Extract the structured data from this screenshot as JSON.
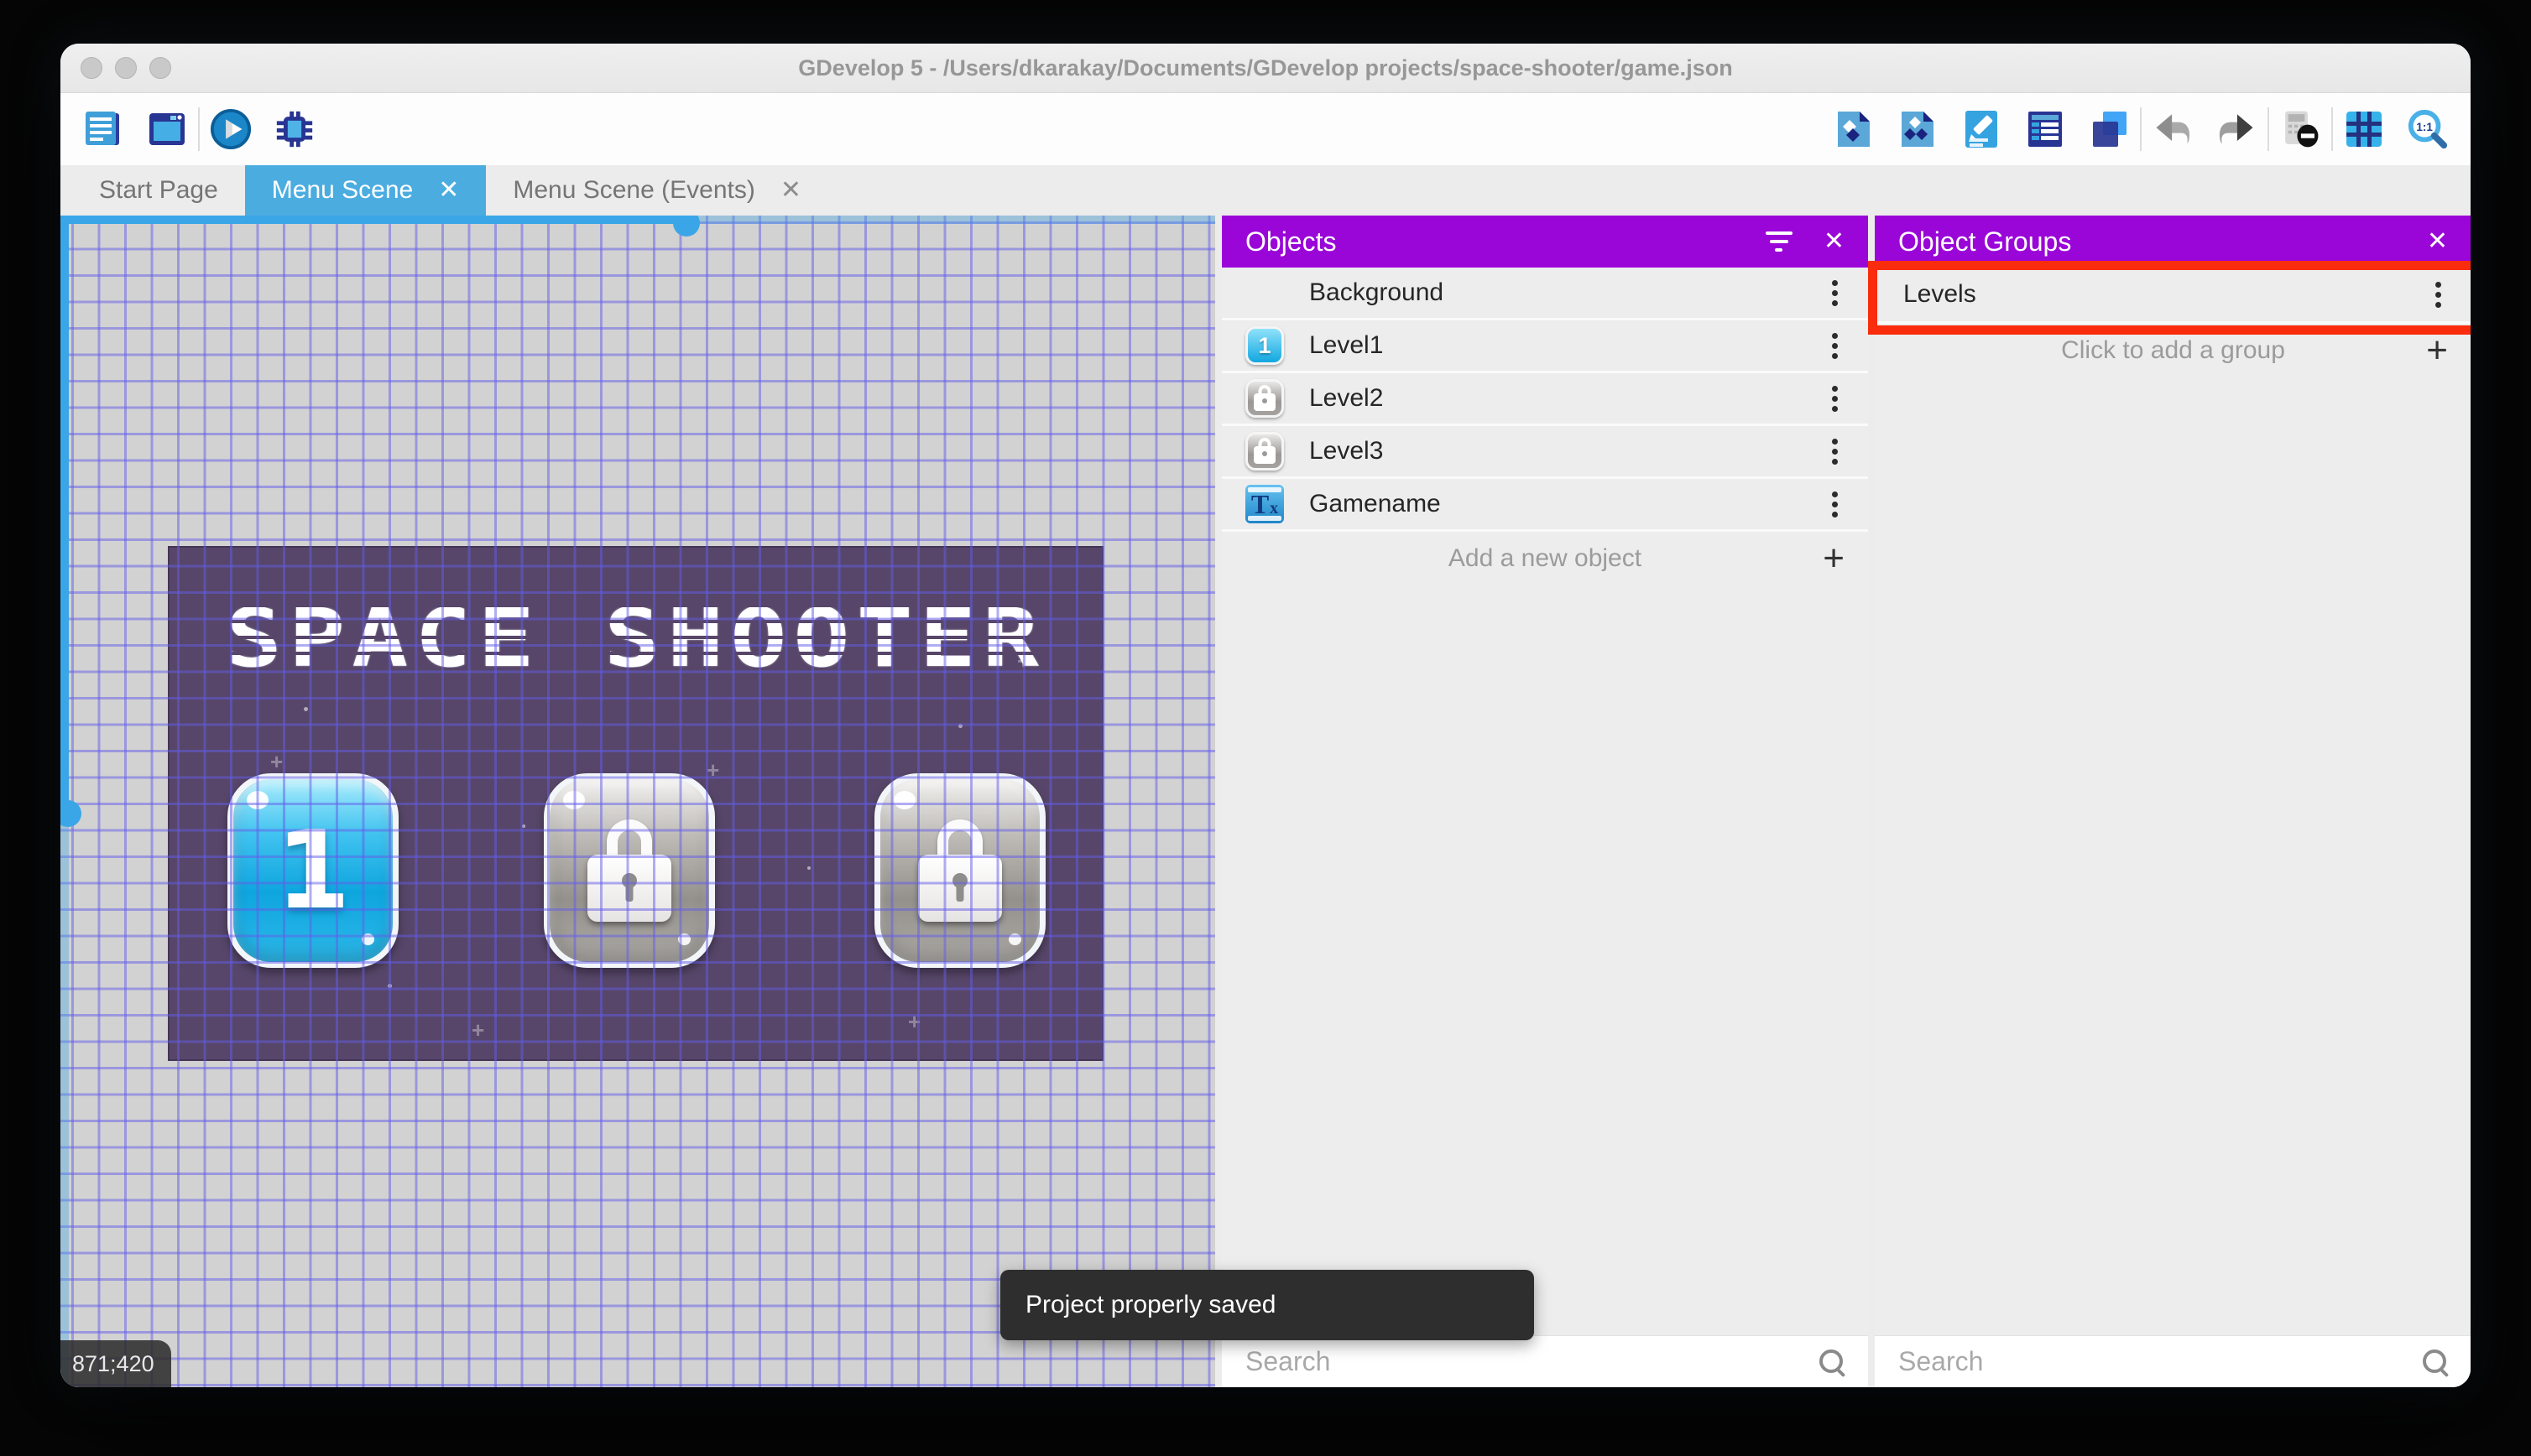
{
  "window": {
    "title": "GDevelop 5 - /Users/dkarakay/Documents/GDevelop projects/space-shooter/game.json"
  },
  "toolbar": {
    "left_icons": [
      "project-manager",
      "open-scene-window",
      "play",
      "debug"
    ],
    "right_icons": [
      "objects-editor",
      "object-groups-editor",
      "properties",
      "instances-list",
      "layers",
      "undo",
      "redo",
      "toggle-instances-mask",
      "grid",
      "zoom-original"
    ]
  },
  "tabs": [
    {
      "label": "Start Page",
      "active": false,
      "closable": false
    },
    {
      "label": "Menu Scene",
      "active": true,
      "closable": true
    },
    {
      "label": "Menu Scene (Events)",
      "active": false,
      "closable": true
    }
  ],
  "glyphs": {
    "close": "✕",
    "plus": "+",
    "tx_t": "T",
    "tx_x": "x"
  },
  "canvas": {
    "game_title": "SPACE SHOOTER",
    "level1_label": "1",
    "coordinates": "871;420"
  },
  "objects_panel": {
    "title": "Objects",
    "items": [
      {
        "name": "Background",
        "icon": "background-swatch"
      },
      {
        "name": "Level1",
        "icon": "level1-button"
      },
      {
        "name": "Level2",
        "icon": "locked-button"
      },
      {
        "name": "Level3",
        "icon": "locked-button"
      },
      {
        "name": "Gamename",
        "icon": "text-object"
      }
    ],
    "add_label": "Add a new object",
    "search_placeholder": "Search"
  },
  "object_groups_panel": {
    "title": "Object Groups",
    "groups": [
      {
        "name": "Levels",
        "highlighted": true
      }
    ],
    "add_label": "Click to add a group",
    "search_placeholder": "Search"
  },
  "toast": {
    "message": "Project properly saved"
  },
  "colors": {
    "accent_blue": "#4bace0",
    "panel_purple": "#9a06d8",
    "annotation_red": "#f92c0d",
    "game_background": "#574669",
    "scrollbar_blue": "#3aa6e8"
  }
}
